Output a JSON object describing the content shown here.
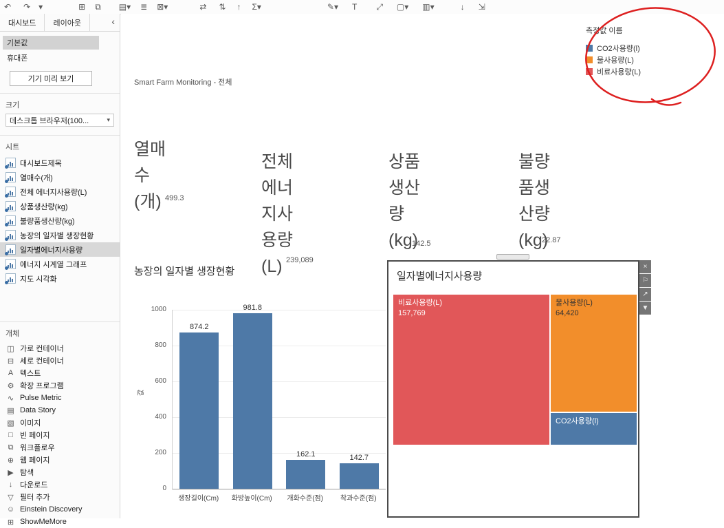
{
  "icons": {
    "caret-down": "▾",
    "chevron-left": "‹"
  },
  "toolbar": {
    "icons": [
      {
        "name": "undo",
        "glyph": "↶"
      },
      {
        "name": "redo",
        "glyph": "↷"
      },
      {
        "name": "revert-menu",
        "glyph": "▾"
      },
      {
        "name": "new-worksheet",
        "glyph": "⊞"
      },
      {
        "name": "duplicate-sheet",
        "glyph": "⧉"
      },
      {
        "name": "new-dashboard",
        "glyph": "▤▾"
      },
      {
        "name": "pause-auto-updates",
        "glyph": "≣"
      },
      {
        "name": "clear-sheet",
        "glyph": "⊠▾"
      },
      {
        "name": "swap-rows-columns",
        "glyph": "⇄"
      },
      {
        "name": "sort-ascending",
        "glyph": "⇅"
      },
      {
        "name": "sort-descending",
        "glyph": "↑"
      },
      {
        "name": "totals",
        "glyph": "Σ▾"
      },
      {
        "name": "highlight",
        "glyph": "✎▾"
      },
      {
        "name": "show-mark-labels",
        "glyph": "T"
      },
      {
        "name": "fit",
        "glyph": "⤢"
      },
      {
        "name": "borders",
        "glyph": "▢▾"
      },
      {
        "name": "show-me",
        "glyph": "▥▾"
      },
      {
        "name": "download",
        "glyph": "↓"
      },
      {
        "name": "device-preview",
        "glyph": "⇲"
      }
    ]
  },
  "sidebar": {
    "tabs": [
      {
        "label": "대시보드"
      },
      {
        "label": "레이아웃"
      }
    ],
    "default_label": "기본값",
    "phone_label": "휴대폰",
    "device_preview_button": "기기 미리 보기",
    "size": {
      "title": "크기",
      "value": "데스크톱 브라우저(100..."
    },
    "sheets": {
      "title": "시트",
      "selected": "일자별에너지사용량",
      "items": [
        {
          "label": "대시보드제목"
        },
        {
          "label": "열매수(개)"
        },
        {
          "label": "전체 에너지사용량(L)"
        },
        {
          "label": "상품생산량(kg)"
        },
        {
          "label": "불량품생산량(kg)"
        },
        {
          "label": "농장의 일자별 생장현황"
        },
        {
          "label": "일자별에너지사용량"
        },
        {
          "label": "에너지 시계열 그래프"
        },
        {
          "label": "지도 시각화"
        }
      ]
    },
    "objects": {
      "title": "개체",
      "items": [
        {
          "icon": "◫",
          "label": "가로 컨테이너"
        },
        {
          "icon": "⊟",
          "label": "세로 컨테이너"
        },
        {
          "icon": "A",
          "label": "텍스트"
        },
        {
          "icon": "⚙",
          "label": "확장 프로그램"
        },
        {
          "icon": "∿",
          "label": "Pulse Metric"
        },
        {
          "icon": "▤",
          "label": "Data Story"
        },
        {
          "icon": "▧",
          "label": "이미지"
        },
        {
          "icon": "□",
          "label": "빈 페이지"
        },
        {
          "icon": "⧉",
          "label": "워크플로우"
        },
        {
          "icon": "⊕",
          "label": "웹 페이지"
        },
        {
          "icon": "▶",
          "label": "탐색"
        },
        {
          "icon": "↓",
          "label": "다운로드"
        },
        {
          "icon": "▽",
          "label": "필터 추가"
        },
        {
          "icon": "☺",
          "label": "Einstein Discovery"
        },
        {
          "icon": "⊞",
          "label": "ShowMeMore"
        }
      ]
    }
  },
  "canvas": {
    "title": "Smart Farm Monitoring - 전체",
    "legend": {
      "title": "측정값 이름",
      "items": [
        {
          "label": "CO2사용량(l)",
          "color": "#4e79a7"
        },
        {
          "label": "물사용량(L)",
          "color": "#f28e2b"
        },
        {
          "label": "비료사용량(L)",
          "color": "#e15759"
        }
      ]
    },
    "kpis": [
      {
        "lines": [
          "열매",
          "수",
          "(개)"
        ],
        "value": "499.3"
      },
      {
        "lines": [
          "전체",
          "에너",
          "지사",
          "용량",
          "(L)"
        ],
        "value": "239,089"
      },
      {
        "lines": [
          "상품",
          "생산",
          "량",
          "(kg)"
        ],
        "value": "142.5"
      },
      {
        "lines": [
          "불량",
          "품생",
          "산량",
          "(kg)"
        ],
        "value": "22.87"
      }
    ],
    "annotation": {
      "type": "hand-drawn-ellipse",
      "color": "#dd1f1f",
      "target": "measure-names-legend"
    }
  },
  "treemap_window": {
    "title": "일자별에너지사용량",
    "controls": [
      {
        "name": "close",
        "glyph": "×"
      },
      {
        "name": "pin",
        "glyph": "⚐"
      },
      {
        "name": "open-external",
        "glyph": "↗"
      },
      {
        "name": "more-options",
        "glyph": "▼"
      }
    ],
    "blocks": [
      {
        "label": "비료사용량(L)",
        "value_text": "157,769",
        "color": "#e15759"
      },
      {
        "label": "물사용량(L)",
        "value_text": "64,420",
        "color": "#f28e2b"
      },
      {
        "label": "CO2사용량(l)",
        "value_text": "",
        "color": "#4e79a7"
      }
    ]
  },
  "chart_data": [
    {
      "type": "bar",
      "title": "농장의 일자별 생장현황",
      "categories": [
        "생장길이(Cm)",
        "화방높이(Cm)",
        "개화수준(점)",
        "착과수준(점)"
      ],
      "values": [
        874.2,
        981.8,
        162.1,
        142.7
      ],
      "xlabel": "",
      "ylabel": "값",
      "ylim": [
        0,
        1000
      ],
      "yticks": [
        0,
        200,
        400,
        600,
        800,
        1000
      ],
      "bar_color": "#4e79a7",
      "grid": true,
      "value_labels": true,
      "legend_position": "none"
    },
    {
      "type": "treemap",
      "title": "일자별에너지사용량",
      "items": [
        {
          "label": "비료사용량(L)",
          "value": 157769,
          "color": "#e15759"
        },
        {
          "label": "물사용량(L)",
          "value": 64420,
          "color": "#f28e2b"
        },
        {
          "label": "CO2사용량(l)",
          "value": null,
          "color": "#4e79a7"
        }
      ]
    }
  ]
}
